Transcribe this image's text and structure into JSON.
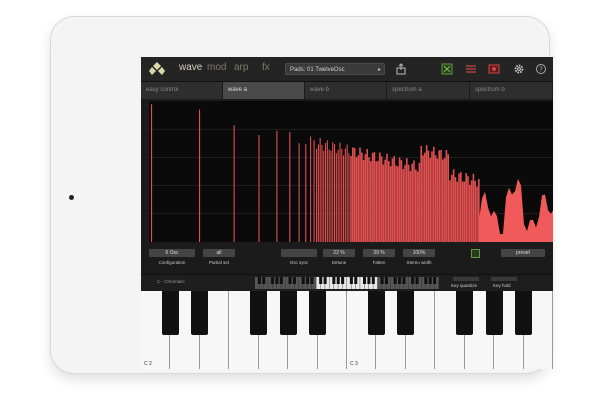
{
  "colors": {
    "accent": "#cfcfb8",
    "spectrum_bar": "#e05050",
    "spectrum_fill": "#f05a5a",
    "toggle_on": "#5c9d3a"
  },
  "topbar": {
    "mode_tabs": [
      {
        "label": "wave",
        "active": true
      },
      {
        "label": "mod",
        "active": false
      },
      {
        "label": "arp",
        "active": false
      },
      {
        "label": "fx",
        "active": false
      }
    ],
    "preset_label": "Pads: 01 TwelveOsc",
    "icons": [
      "share-icon",
      "toggle-icon",
      "mixer-icon",
      "record-icon",
      "gear-icon",
      "help-icon"
    ]
  },
  "wave_tabs": [
    {
      "label": "easy control",
      "active": false
    },
    {
      "label": "wave a",
      "active": true
    },
    {
      "label": "wave b",
      "active": false
    },
    {
      "label": "spectrum a",
      "active": false
    },
    {
      "label": "spectrum b",
      "active": false
    }
  ],
  "controls": {
    "configuration_value": "6 Osc",
    "configuration_label": "Configuration",
    "partial_set_value": "all",
    "partial_set_label": "Partial set",
    "osc_sync_value": "",
    "osc_sync_label": "Osc sync",
    "detune_value": "22 %",
    "detune_label": "Detune",
    "fatten_value": "39 %",
    "fatten_label": "Fatten",
    "stereo_width_value": "100%",
    "stereo_width_label": "Stereo width",
    "preset_button": "preset"
  },
  "keyboard_strip": {
    "scale_label": "C - Chromatic",
    "key_quantize_label": "Key quantize",
    "key_hold_label": "Key hold"
  },
  "keyboard": {
    "octave_labels": [
      "C 2",
      "C 3"
    ]
  }
}
